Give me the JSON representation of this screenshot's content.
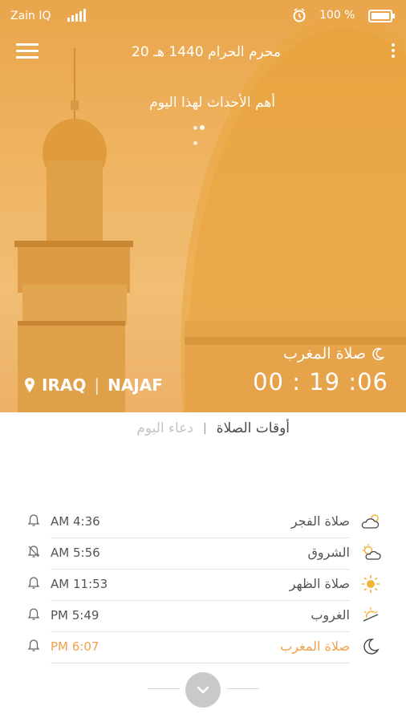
{
  "status": {
    "carrier": "Zain IQ",
    "battery": "100 %"
  },
  "header": {
    "hijri_date": "20 محرم الحرام 1440 هـ",
    "events_title": "أهم الأحداث لهذا اليوم"
  },
  "hero": {
    "country": "IRAQ",
    "city": "NAJAF",
    "next_prayer": "صلاة المغرب",
    "countdown": "00 : 19 :06"
  },
  "tabs": {
    "active": "أوقات الصلاة",
    "inactive": "دعاء اليوم"
  },
  "prayers": [
    {
      "name": "صلاة الفجر",
      "time": "AM 4:36",
      "icon": "cloud-sun-icon",
      "active": false
    },
    {
      "name": "الشروق",
      "time": "AM 5:56",
      "icon": "sunrise-cloud-icon",
      "active": false
    },
    {
      "name": "صلاة الظهر",
      "time": "AM 11:53",
      "icon": "sun-icon",
      "active": false
    },
    {
      "name": "الغروب",
      "time": "PM 5:49",
      "icon": "sunset-icon",
      "active": false
    },
    {
      "name": "صلاة المغرب",
      "time": "PM 6:07",
      "icon": "moon-icon",
      "active": true
    }
  ],
  "colors": {
    "accent": "#eea24a",
    "hero_tint": "#efb25f",
    "text": "#555555",
    "muted": "#c4c4c4"
  }
}
